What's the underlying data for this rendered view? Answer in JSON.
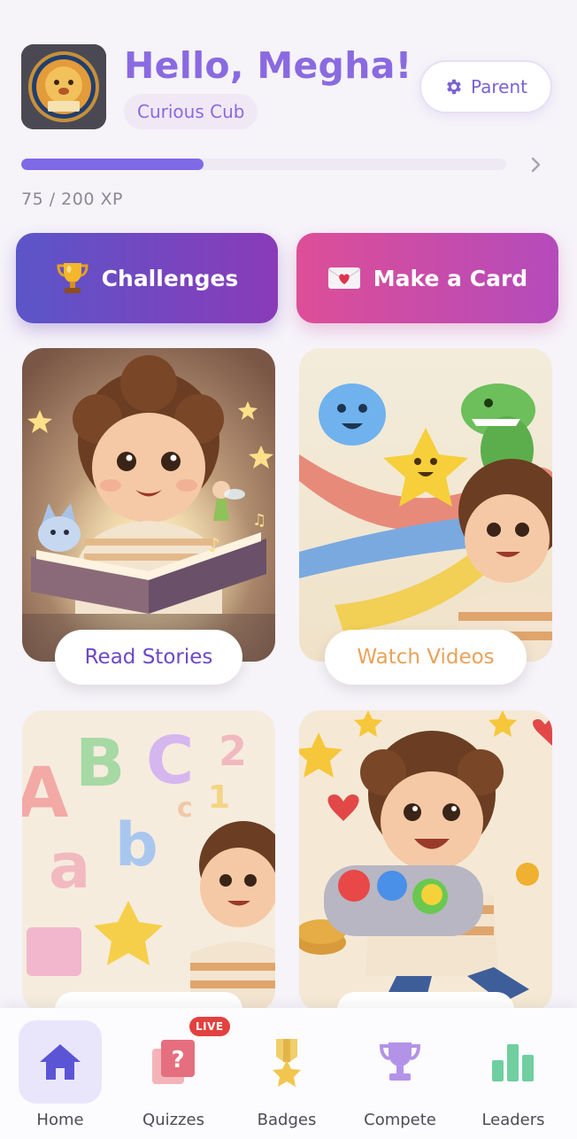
{
  "header": {
    "greeting": "Hello, Megha!",
    "rank": "Curious Cub",
    "parent_button": "Parent"
  },
  "xp": {
    "text": "75 / 200 XP",
    "current": 75,
    "max": 200
  },
  "actions": {
    "challenges": "Challenges",
    "make_card": "Make a Card"
  },
  "tiles": {
    "read_stories": "Read Stories",
    "watch_videos": "Watch Videos"
  },
  "nav": {
    "home": "Home",
    "quizzes": "Quizzes",
    "quizzes_badge": "LIVE",
    "badges": "Badges",
    "compete": "Compete",
    "leaders": "Leaders"
  },
  "icons": {
    "parent": "gear-icon",
    "xp_more": "chevron-right-icon",
    "challenges": "trophy-icon",
    "make_card": "envelope-heart-icon",
    "home": "home-icon",
    "quizzes": "quiz-card-icon",
    "badges": "medal-icon",
    "compete": "cup-icon",
    "leaders": "bar-chart-icon"
  },
  "colors": {
    "accent": "#7e6ae6",
    "challenges_gradient": [
      "#5b55c9",
      "#8a3bb8"
    ],
    "make_card_gradient": [
      "#dd4e97",
      "#b44bbb"
    ],
    "live_badge": "#e2413f"
  }
}
